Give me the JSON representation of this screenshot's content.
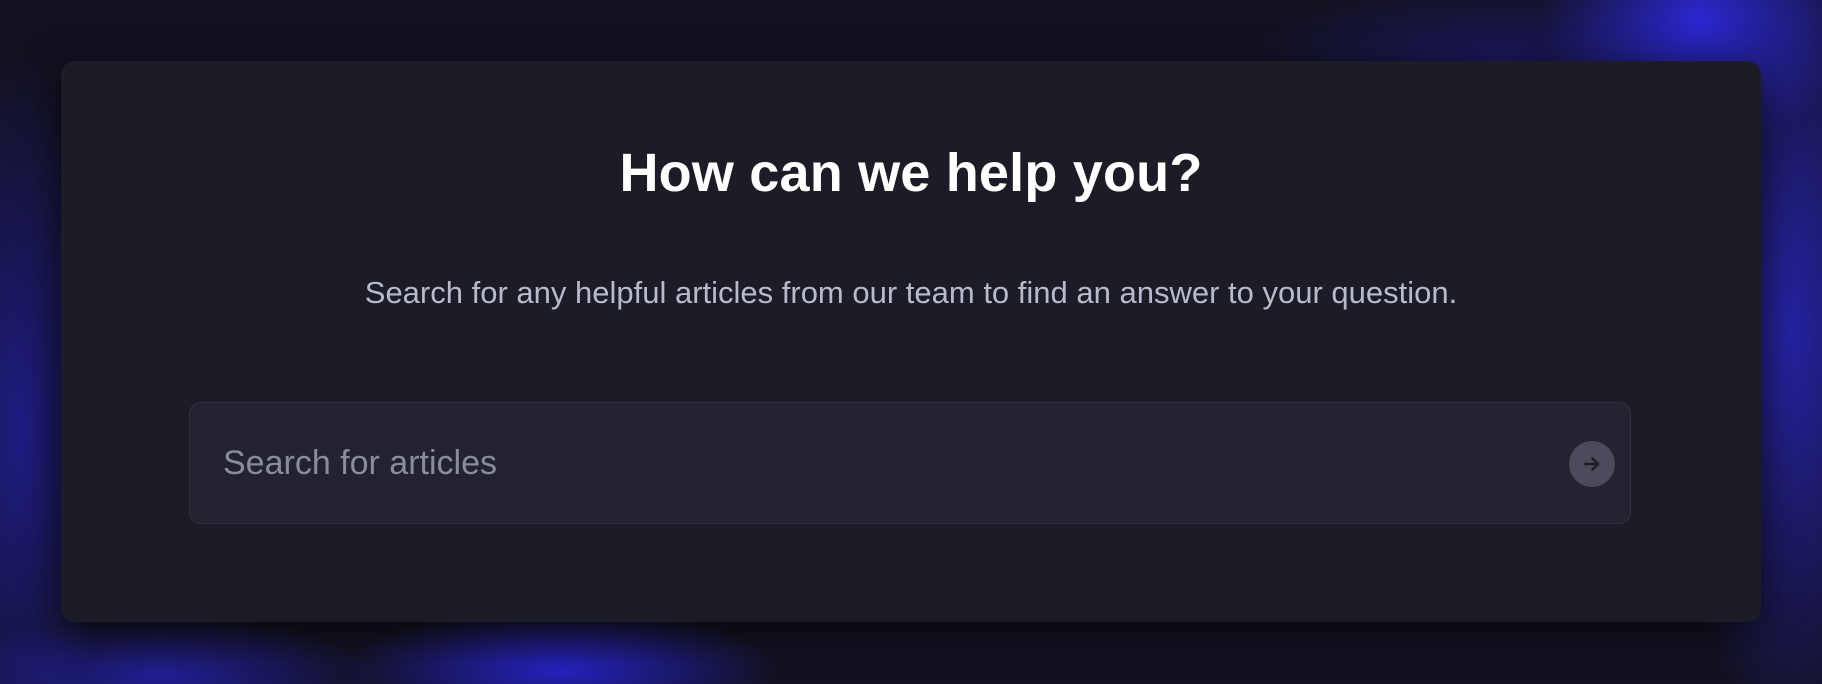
{
  "help": {
    "title": "How can we help you?",
    "subtitle": "Search for any helpful articles from our team to find an answer to your question."
  },
  "search": {
    "placeholder": "Search for articles",
    "value": "",
    "submit_icon": "arrow-right-icon"
  },
  "colors": {
    "background": "#12111f",
    "card": "#1c1c27",
    "input": "#232330",
    "accent_glow": "#2d28dc",
    "submit_button": "#4b4b5c"
  }
}
